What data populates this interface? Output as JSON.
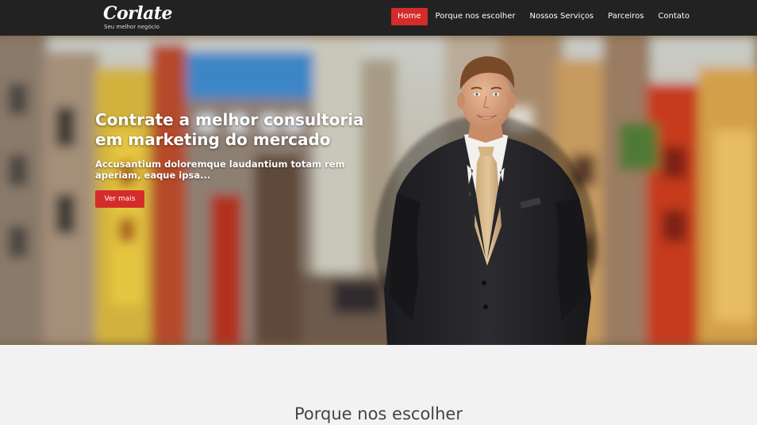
{
  "brand": {
    "name": "Corlate",
    "tagline": "Seu melhor negócio"
  },
  "nav": {
    "items": [
      {
        "label": "Home",
        "active": true
      },
      {
        "label": "Porque nos escolher",
        "active": false
      },
      {
        "label": "Nossos Serviços",
        "active": false
      },
      {
        "label": "Parceiros",
        "active": false
      },
      {
        "label": "Contato",
        "active": false
      }
    ]
  },
  "hero": {
    "title": "Contrate a melhor consultoria em marketing do mercado",
    "subtitle": "Accusantium doloremque laudantium totam rem aperiam, eaque ipsa...",
    "button_label": "Ver mais",
    "image": "blurred-city-street-with-businessman-in-suit"
  },
  "section": {
    "title": "Porque nos escolher"
  },
  "colors": {
    "navbar_bg": "#222222",
    "accent": "#d42b2b",
    "page_bg": "#f2f2f2",
    "heading_text": "#444444"
  }
}
